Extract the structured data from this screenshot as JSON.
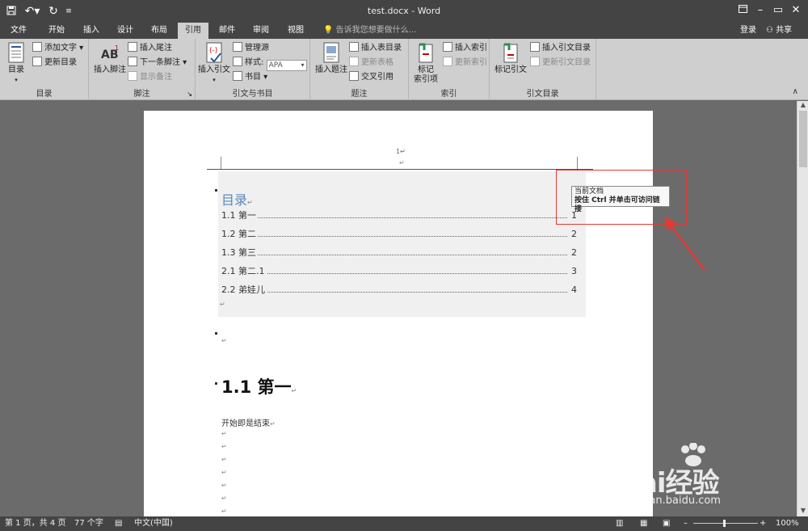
{
  "window": {
    "title": "test.docx - Word",
    "login": "登录",
    "share": "共享"
  },
  "tabs": [
    "文件",
    "开始",
    "插入",
    "设计",
    "布局",
    "引用",
    "邮件",
    "审阅",
    "视图"
  ],
  "active_tab": "引用",
  "tell_me": "告诉我您想要做什么...",
  "ribbon": {
    "toc_group": {
      "label": "目录",
      "toc_button": "目录",
      "add_text": "添加文字",
      "update_toc": "更新目录"
    },
    "footnote_group": {
      "label": "脚注",
      "insert_footnote": "插入脚注",
      "insert_endnote": "插入尾注",
      "next_footnote": "下一条脚注",
      "show_notes": "显示备注"
    },
    "citation_group": {
      "label": "引文与书目",
      "insert_citation": "插入引文",
      "manage_sources": "管理源",
      "style_label": "样式:",
      "style_value": "APA",
      "bibliography": "书目"
    },
    "caption_group": {
      "label": "题注",
      "insert_caption": "插入题注",
      "insert_table_figures": "插入表目录",
      "update_table": "更新表格",
      "cross_reference": "交叉引用"
    },
    "index_group": {
      "label": "索引",
      "mark_entry": "标记\n索引项",
      "insert_index": "插入索引",
      "update_index": "更新索引"
    },
    "authorities_group": {
      "label": "引文目录",
      "mark_citation": "标记引文",
      "insert_authorities": "插入引文目录",
      "update_authorities": "更新引文目录"
    }
  },
  "document": {
    "page_number": "1↵",
    "toc_title": "目录",
    "toc_entries": [
      {
        "text": "1.1 第一",
        "page": "1"
      },
      {
        "text": "1.2 第二",
        "page": "2"
      },
      {
        "text": "1.3  第三",
        "page": "2"
      },
      {
        "text": "2.1  第二.1",
        "page": "3"
      },
      {
        "text": "2.2 弟娃儿",
        "page": "4"
      }
    ],
    "heading": "1.1 第一",
    "body_text": "开始即是结束",
    "return_mark": "↵"
  },
  "tooltip": {
    "line1": "当前文档",
    "line2": "按住 Ctrl 并单击可访问链接"
  },
  "status": {
    "page": "第 1 页，共 4 页",
    "words": "77 个字",
    "language": "中文(中国)",
    "zoom": "100%"
  },
  "watermark": {
    "brand": "Bai经验",
    "url": "jingyan.baidu.com"
  },
  "colors": {
    "accent_red": "#e53935",
    "toc_title_blue": "#5b87bf"
  }
}
